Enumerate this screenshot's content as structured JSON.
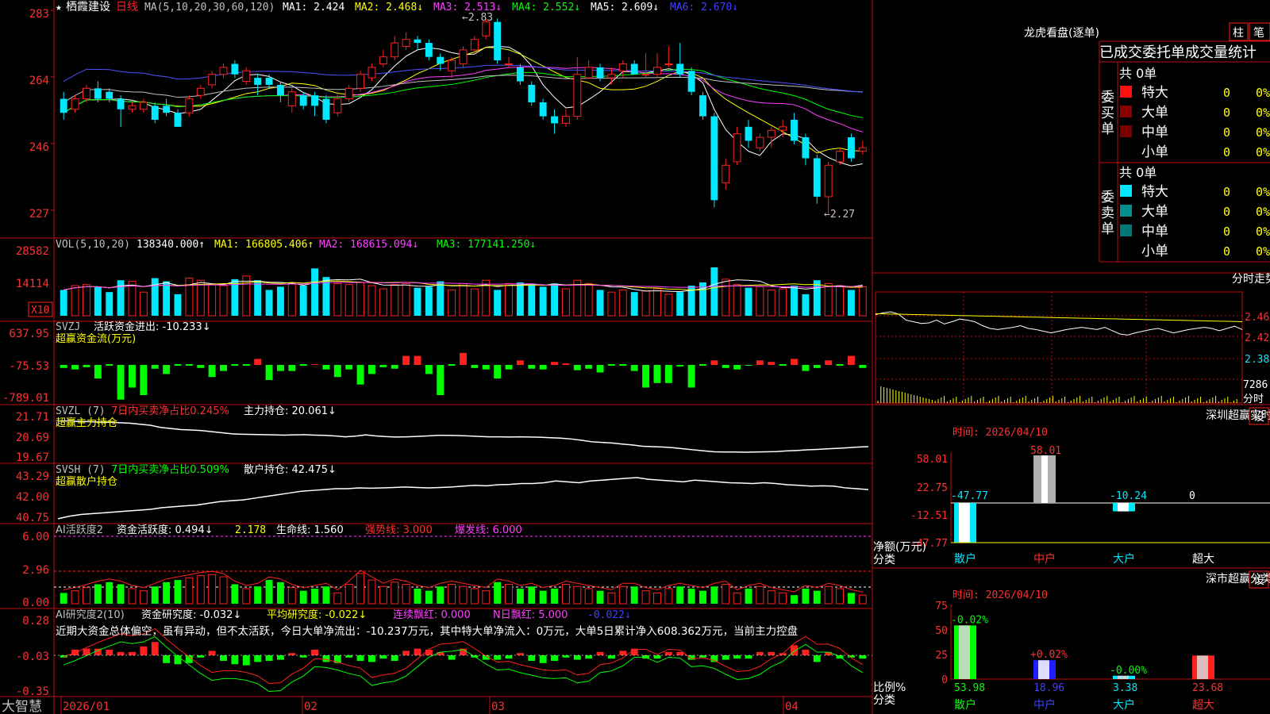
{
  "app": {
    "name": "大智慧"
  },
  "stock": {
    "name": "栖霞建设",
    "period": "日线"
  },
  "colors": {
    "up": "#ff2020",
    "down": "#00e8ff",
    "green": "#00ff00",
    "white": "#ffffff",
    "yellow": "#ffff00",
    "magenta": "#ff40ff",
    "blue": "#5050ff"
  },
  "main": {
    "ma_label": "MA(5,10,20,30,60,120)",
    "ma1": "MA1: 2.424",
    "ma2": "MA2: 2.468↓",
    "ma3": "MA3: 2.513↓",
    "ma4": "MA4: 2.552↓",
    "ma5": "MA5: 2.609↓",
    "ma6": "MA6: 2.670↓",
    "yaxis": [
      "283",
      "264",
      "246",
      "227"
    ],
    "high_label": "←2.83",
    "low_label": "←2.27"
  },
  "vol": {
    "label": "VOL(5,10,20)",
    "value": "138340.000↑",
    "ma1": "MA1: 166805.406↑",
    "ma2": "MA2: 168615.094↓",
    "ma3": "MA3: 177141.250↓",
    "yaxis": [
      "28582",
      "14114"
    ],
    "unit": "X10"
  },
  "svzj": {
    "label": "SVZJ",
    "text": "活跃资金进出: -10.233↓",
    "sub": "超赢资金流(万元)",
    "yaxis": [
      "637.95",
      "-75.53",
      "-789.01"
    ]
  },
  "svzl": {
    "label": "SVZL (7)",
    "text1": "7日内买卖净占比0.245%",
    "text2": "主力持仓: 20.061↓",
    "sub": "超赢主力持仓",
    "yaxis": [
      "21.71",
      "20.69",
      "19.67"
    ]
  },
  "svsh": {
    "label": "SVSH (7)",
    "text1": "7日内买卖净占比0.509%",
    "text2": "散户持仓: 42.475↓",
    "sub": "超赢散户持仓",
    "yaxis": [
      "43.29",
      "42.00",
      "40.75"
    ]
  },
  "ai1": {
    "label": "AI活跃度2",
    "t1": "资金活跃度: 0.494↓",
    "t2": "2.178",
    "t3": "生命线: 1.560",
    "t4": "强势线: 3.000",
    "t5": "爆发线: 6.000",
    "yaxis": [
      "6.00",
      "2.96",
      "0.00"
    ]
  },
  "ai2": {
    "label": "AI研究度2(10)",
    "t1": "资金研究度: -0.032↓",
    "t2": "平均研究度: -0.022↓",
    "t3": "连续飘红: 0.000",
    "t4": "N日飘红: 5.000",
    "t5": "-0.022↓",
    "desc": "近期大资金总体偏空，虽有异动，但不太活跃，今日大单净流出：-10.237万元，其中特大单净流入：0万元，大单5日累计净入608.362万元，当前主力控盘",
    "yaxis": [
      "0.28",
      "-0.03",
      "-0.35"
    ]
  },
  "dates": [
    "2026/01",
    "02",
    "03",
    "04"
  ],
  "right": {
    "lhb_title": "龙虎看盘(逐单)",
    "btn_zhu": "柱",
    "btn_bi": "笔",
    "tab_title": "已成交委托单成交量统计",
    "buy": {
      "side": "委买单",
      "total": "共 0单",
      "rows": [
        [
          "特大",
          "0",
          "0%"
        ],
        [
          "大单",
          "0",
          "0%"
        ],
        [
          "中单",
          "0",
          "0%"
        ],
        [
          "小单",
          "0",
          "0%"
        ]
      ]
    },
    "sell": {
      "side": "委卖单",
      "total": "共 0单",
      "rows": [
        [
          "特大",
          "0",
          "0%"
        ],
        [
          "大单",
          "0",
          "0%"
        ],
        [
          "中单",
          "0",
          "0%"
        ],
        [
          "小单",
          "0",
          "0%"
        ]
      ]
    },
    "fs_title": "分时走势",
    "fs_yaxis": [
      "2.460",
      "2.420",
      "2.380"
    ],
    "fs_vol": "7286",
    "fs_vol_unit": "分时",
    "mon": {
      "title": "深圳超赢实时监控",
      "set": "设",
      "time": "时间: 2026/04/10",
      "yaxis": [
        "58.01",
        "22.75",
        "-12.51",
        "-47.77"
      ],
      "ylabel": "净额(万元)",
      "xlabel": "分类",
      "cats": [
        "散户",
        "中户",
        "大户",
        "超大"
      ],
      "values": [
        -47.77,
        58.01,
        -10.24,
        0
      ],
      "labels": [
        "-47.77",
        "58.01",
        "-10.24",
        "0"
      ]
    },
    "cls": {
      "title": "深市超赢分类统计",
      "set": "设",
      "time": "时间: 2026/04/10",
      "yaxis": [
        "75",
        "50",
        "25",
        "0"
      ],
      "ylabel": "比例%",
      "xlabel": "分类",
      "cats": [
        "散户",
        "中户",
        "大户",
        "超大"
      ],
      "values": [
        53.98,
        18.96,
        3.38,
        23.68
      ],
      "changes": [
        "-0.02%",
        "+0.02%",
        "-0.00%",
        ""
      ],
      "labels": [
        "53.98",
        "18.96",
        "3.38",
        "23.68"
      ]
    }
  },
  "chart_data": {
    "type": "candlestick",
    "ylim": [
      2.22,
      2.86
    ],
    "candles": [
      [
        2.6,
        2.56,
        2.62,
        2.54
      ],
      [
        2.57,
        2.6,
        2.61,
        2.56
      ],
      [
        2.6,
        2.63,
        2.64,
        2.59
      ],
      [
        2.63,
        2.6,
        2.65,
        2.59
      ],
      [
        2.62,
        2.6,
        2.63,
        2.59
      ],
      [
        2.6,
        2.57,
        2.61,
        2.52
      ],
      [
        2.57,
        2.58,
        2.59,
        2.56
      ],
      [
        2.57,
        2.59,
        2.6,
        2.56
      ],
      [
        2.58,
        2.54,
        2.59,
        2.53
      ],
      [
        2.58,
        2.56,
        2.6,
        2.55
      ],
      [
        2.56,
        2.52,
        2.57,
        2.52
      ],
      [
        2.56,
        2.6,
        2.61,
        2.55
      ],
      [
        2.61,
        2.63,
        2.64,
        2.6
      ],
      [
        2.64,
        2.67,
        2.68,
        2.63
      ],
      [
        2.67,
        2.69,
        2.7,
        2.66
      ],
      [
        2.7,
        2.67,
        2.71,
        2.66
      ],
      [
        2.65,
        2.68,
        2.69,
        2.64
      ],
      [
        2.66,
        2.64,
        2.67,
        2.61
      ],
      [
        2.66,
        2.64,
        2.67,
        2.63
      ],
      [
        2.64,
        2.61,
        2.65,
        2.59
      ],
      [
        2.58,
        2.62,
        2.63,
        2.56
      ],
      [
        2.61,
        2.58,
        2.62,
        2.57
      ],
      [
        2.61,
        2.58,
        2.62,
        2.55
      ],
      [
        2.6,
        2.54,
        2.61,
        2.53
      ],
      [
        2.56,
        2.6,
        2.62,
        2.55
      ],
      [
        2.6,
        2.63,
        2.64,
        2.59
      ],
      [
        2.63,
        2.67,
        2.68,
        2.62
      ],
      [
        2.66,
        2.69,
        2.7,
        2.65
      ],
      [
        2.7,
        2.72,
        2.74,
        2.69
      ],
      [
        2.72,
        2.76,
        2.78,
        2.71
      ],
      [
        2.75,
        2.77,
        2.79,
        2.74
      ],
      [
        2.77,
        2.76,
        2.78,
        2.74
      ],
      [
        2.76,
        2.72,
        2.77,
        2.71
      ],
      [
        2.72,
        2.7,
        2.73,
        2.68
      ],
      [
        2.68,
        2.71,
        2.72,
        2.66
      ],
      [
        2.7,
        2.74,
        2.75,
        2.69
      ],
      [
        2.74,
        2.77,
        2.78,
        2.73
      ],
      [
        2.78,
        2.82,
        2.83,
        2.77
      ],
      [
        2.82,
        2.71,
        2.83,
        2.7
      ],
      [
        2.7,
        2.7,
        2.72,
        2.69
      ],
      [
        2.69,
        2.65,
        2.7,
        2.64
      ],
      [
        2.64,
        2.59,
        2.65,
        2.58
      ],
      [
        2.59,
        2.55,
        2.6,
        2.54
      ],
      [
        2.55,
        2.53,
        2.57,
        2.5
      ],
      [
        2.53,
        2.55,
        2.57,
        2.52
      ],
      [
        2.55,
        2.67,
        2.72,
        2.54
      ],
      [
        2.66,
        2.69,
        2.71,
        2.66
      ],
      [
        2.69,
        2.66,
        2.7,
        2.65
      ],
      [
        2.66,
        2.67,
        2.69,
        2.64
      ],
      [
        2.68,
        2.7,
        2.71,
        2.66
      ],
      [
        2.7,
        2.67,
        2.71,
        2.67
      ],
      [
        2.67,
        2.67,
        2.73,
        2.66
      ],
      [
        2.67,
        2.69,
        2.73,
        2.66
      ],
      [
        2.7,
        2.7,
        2.75,
        2.69
      ],
      [
        2.7,
        2.67,
        2.76,
        2.66
      ],
      [
        2.68,
        2.62,
        2.69,
        2.61
      ],
      [
        2.61,
        2.55,
        2.62,
        2.54
      ],
      [
        2.55,
        2.31,
        2.56,
        2.29
      ],
      [
        2.36,
        2.41,
        2.43,
        2.34
      ],
      [
        2.42,
        2.5,
        2.52,
        2.41
      ],
      [
        2.52,
        2.48,
        2.54,
        2.46
      ],
      [
        2.46,
        2.49,
        2.5,
        2.45
      ],
      [
        2.49,
        2.51,
        2.52,
        2.46
      ],
      [
        2.51,
        2.52,
        2.54,
        2.49
      ],
      [
        2.54,
        2.48,
        2.56,
        2.47
      ],
      [
        2.49,
        2.43,
        2.5,
        2.41
      ],
      [
        2.43,
        2.32,
        2.44,
        2.3
      ],
      [
        2.32,
        2.41,
        2.42,
        2.27
      ],
      [
        2.42,
        2.45,
        2.46,
        2.41
      ],
      [
        2.49,
        2.43,
        2.5,
        2.42
      ],
      [
        2.45,
        2.46,
        2.48,
        2.44
      ]
    ],
    "volumes": [
      12000,
      14000,
      14500,
      13500,
      11000,
      16500,
      16000,
      11000,
      17500,
      16000,
      10000,
      17500,
      16500,
      14500,
      14000,
      17000,
      18500,
      16500,
      12000,
      13500,
      15000,
      14000,
      22000,
      18000,
      15000,
      14500,
      15500,
      14000,
      12500,
      14500,
      15000,
      13000,
      13500,
      16000,
      12000,
      15000,
      12500,
      16500,
      12000,
      15000,
      15500,
      15000,
      13500,
      15000,
      12500,
      16500,
      15000,
      12000,
      11000,
      12000,
      11000,
      11500,
      12500,
      10000,
      11000,
      14000,
      15500,
      22500,
      17000,
      14500,
      13000,
      13500,
      12000,
      12500,
      14000,
      10000,
      16500,
      15000,
      14000,
      12000,
      13500
    ],
    "flow": [
      -20,
      -30,
      -15,
      -90,
      0,
      -230,
      -150,
      -200,
      -25,
      -60,
      0,
      0,
      -20,
      -80,
      -40,
      0,
      0,
      40,
      -100,
      -40,
      -40,
      0,
      5,
      -30,
      -80,
      -30,
      -130,
      -60,
      -15,
      -25,
      60,
      60,
      -60,
      -200,
      0,
      80,
      -20,
      -30,
      -90,
      -30,
      30,
      -25,
      -30,
      20,
      10,
      -35,
      -25,
      -50,
      0,
      0,
      -40,
      -150,
      -120,
      -120,
      -10,
      -150,
      0,
      30,
      -20,
      -30,
      -5,
      30,
      20,
      0,
      40,
      -40,
      -20,
      30,
      0,
      60,
      -20
    ],
    "zl": [
      21.5,
      21.5,
      21.48,
      21.47,
      21.45,
      21.44,
      21.42,
      21.4,
      21.35,
      21.3,
      21.2,
      21.15,
      21.1,
      21.08,
      21.05,
      21.0,
      20.95,
      20.9,
      20.88,
      20.87,
      20.86,
      20.85,
      20.84,
      20.85,
      20.86,
      20.84,
      20.83,
      20.8,
      20.76,
      20.79,
      20.85,
      20.8,
      20.77,
      20.75,
      20.76,
      20.78,
      20.8,
      20.83,
      20.83,
      20.82,
      20.8,
      20.78,
      20.76,
      20.76,
      20.75,
      20.76,
      20.75,
      20.74,
      20.72,
      20.7,
      20.66,
      20.6,
      20.53,
      20.5,
      20.47,
      20.42,
      20.38,
      20.32,
      20.3,
      20.28,
      20.25,
      20.2,
      20.15,
      20.1,
      20.06,
      20.05,
      20.05,
      20.04,
      20.05,
      20.06,
      20.07,
      20.1,
      20.12,
      20.15,
      20.17,
      20.2,
      20.22,
      20.25,
      20.28,
      20.3
    ],
    "sh": [
      40.8,
      40.95,
      41.05,
      41.1,
      41.15,
      41.2,
      41.25,
      41.3,
      41.35,
      41.45,
      41.5,
      41.55,
      41.6,
      41.7,
      41.8,
      41.85,
      41.9,
      42.0,
      42.1,
      42.2,
      42.3,
      42.4,
      42.45,
      42.5,
      42.55,
      42.55,
      42.6,
      42.58,
      42.6,
      42.62,
      42.65,
      42.62,
      42.6,
      42.62,
      42.65,
      42.7,
      42.75,
      42.72,
      42.78,
      42.8,
      42.85,
      42.85,
      42.9,
      43.0,
      42.95,
      42.9,
      43.0,
      43.05,
      43.1,
      43.15,
      43.2,
      43.1,
      43.05,
      43.0,
      42.95,
      43.05,
      43.0,
      42.95,
      42.9,
      42.88,
      42.85,
      42.9,
      42.85,
      42.78,
      42.75,
      42.7,
      42.72,
      42.7,
      42.6,
      42.55,
      42.5
    ],
    "act": [
      1.0,
      1.2,
      1.5,
      1.8,
      2.0,
      1.8,
      1.4,
      1.2,
      1.6,
      2.0,
      2.2,
      2.4,
      2.6,
      2.7,
      2.5,
      1.8,
      1.4,
      1.6,
      2.2,
      2.0,
      1.5,
      1.2,
      1.4,
      1.6,
      1.0,
      1.8,
      2.8,
      2.2,
      1.6,
      2.0,
      1.8,
      1.4,
      1.2,
      1.6,
      1.8,
      1.6,
      1.4,
      1.2,
      2.0,
      1.8,
      1.4,
      1.6,
      1.2,
      1.4,
      1.8,
      1.6,
      1.4,
      1.2,
      1.0,
      1.6,
      1.6,
      1.2,
      1.0,
      1.4,
      1.6,
      1.4,
      1.2,
      1.6,
      1.8,
      1.0,
      1.4,
      1.6,
      1.2,
      1.0,
      0.8,
      1.4,
      1.2,
      1.6,
      1.4,
      1.0,
      0.8
    ],
    "yj": [
      -0.02,
      0.05,
      0.06,
      0.06,
      0.05,
      0.03,
      0.03,
      0.08,
      0.12,
      -0.07,
      -0.08,
      -0.07,
      -0.02,
      0.04,
      -0.05,
      -0.08,
      -0.09,
      -0.06,
      -0.05,
      -0.04,
      0.02,
      -0.02,
      0.05,
      -0.06,
      -0.07,
      -0.02,
      -0.05,
      -0.06,
      -0.03,
      -0.05,
      0.04,
      0.06,
      0.05,
      0.03,
      -0.04,
      0.06,
      -0.02,
      -0.04,
      -0.04,
      -0.03,
      0.02,
      -0.05,
      -0.07,
      -0.05,
      -0.02,
      -0.04,
      -0.03,
      0.03,
      -0.03,
      0.04,
      0.06,
      -0.03,
      -0.03,
      0.03,
      0.03,
      -0.04,
      -0.02,
      -0.06,
      -0.04,
      -0.03,
      -0.03,
      0.03,
      0.03,
      0.02,
      0.09,
      0.05,
      -0.06,
      0.03,
      -0.03,
      -0.02,
      -0.03
    ]
  },
  "fenshi": [
    2.465,
    2.468,
    2.47,
    2.466,
    2.455,
    2.452,
    2.449,
    2.45,
    2.455,
    2.448,
    2.452,
    2.457,
    2.455,
    2.452,
    2.445,
    2.44,
    2.438,
    2.44,
    2.442,
    2.445,
    2.44,
    2.438,
    2.435,
    2.432,
    2.435,
    2.438,
    2.44,
    2.442,
    2.44,
    2.438,
    2.442,
    2.436,
    2.43,
    2.428,
    2.432,
    2.435,
    2.438,
    2.44,
    2.436,
    2.432,
    2.435,
    2.438,
    2.44,
    2.442,
    2.44,
    2.436,
    2.44,
    2.444,
    2.438
  ]
}
